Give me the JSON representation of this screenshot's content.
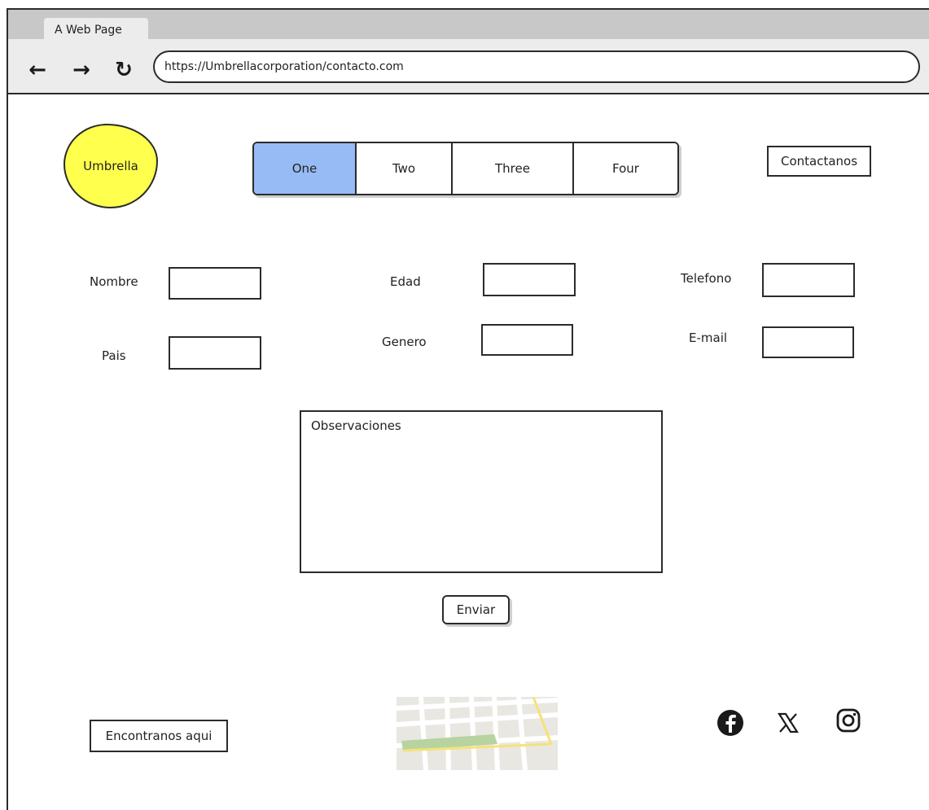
{
  "browser": {
    "tab_title": "A Web Page",
    "url": "https://Umbrellacorporation/contacto.com",
    "nav": {
      "back_glyph": "←",
      "forward_glyph": "→",
      "reload_glyph": "↻"
    }
  },
  "header": {
    "logo": "Umbrella",
    "tabs": [
      {
        "label": "One",
        "active": true
      },
      {
        "label": "Two",
        "active": false
      },
      {
        "label": "Three",
        "active": false
      },
      {
        "label": "Four",
        "active": false
      }
    ],
    "contact_button": "Contactanos"
  },
  "form": {
    "fields": {
      "nombre": {
        "label": "Nombre",
        "value": ""
      },
      "edad": {
        "label": "Edad",
        "value": ""
      },
      "telefono": {
        "label": "Telefono",
        "value": ""
      },
      "pais": {
        "label": "Pais",
        "value": ""
      },
      "genero": {
        "label": "Genero",
        "value": ""
      },
      "email": {
        "label": "E-mail",
        "value": ""
      }
    },
    "observaciones_placeholder": "Observaciones",
    "submit": "Enviar"
  },
  "footer": {
    "location_button": "Encontranos aqui",
    "social": [
      "facebook-icon",
      "x-icon",
      "instagram-icon"
    ]
  },
  "colors": {
    "active_tab": "#97bbf4",
    "logo": "#ffff4d",
    "ink": "#2b2b2b"
  }
}
